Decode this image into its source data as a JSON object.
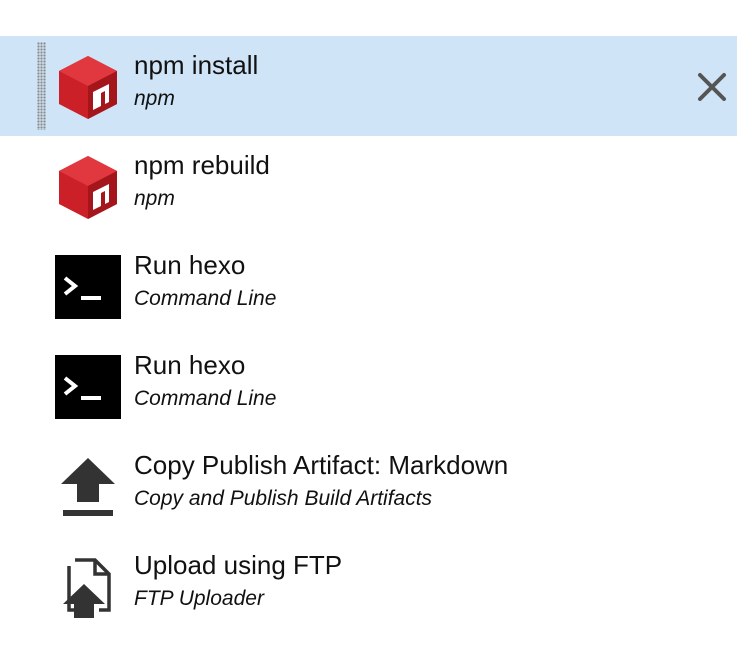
{
  "tasks": [
    {
      "title": "npm install",
      "subtitle": "npm",
      "icon": "npm-icon",
      "selected": true
    },
    {
      "title": "npm rebuild",
      "subtitle": "npm",
      "icon": "npm-icon",
      "selected": false
    },
    {
      "title": "Run hexo",
      "subtitle": "Command Line",
      "icon": "command-line-icon",
      "selected": false
    },
    {
      "title": "Run hexo",
      "subtitle": "Command Line",
      "icon": "command-line-icon",
      "selected": false
    },
    {
      "title": "Copy Publish Artifact: Markdown",
      "subtitle": "Copy and Publish Build Artifacts",
      "icon": "upload-arrow-icon",
      "selected": false
    },
    {
      "title": "Upload using FTP",
      "subtitle": "FTP Uploader",
      "icon": "ftp-upload-icon",
      "selected": false
    }
  ],
  "colors": {
    "selected_row": "#cfe4f6",
    "npm_red": "#cb2027",
    "icon_dark": "#333333"
  }
}
